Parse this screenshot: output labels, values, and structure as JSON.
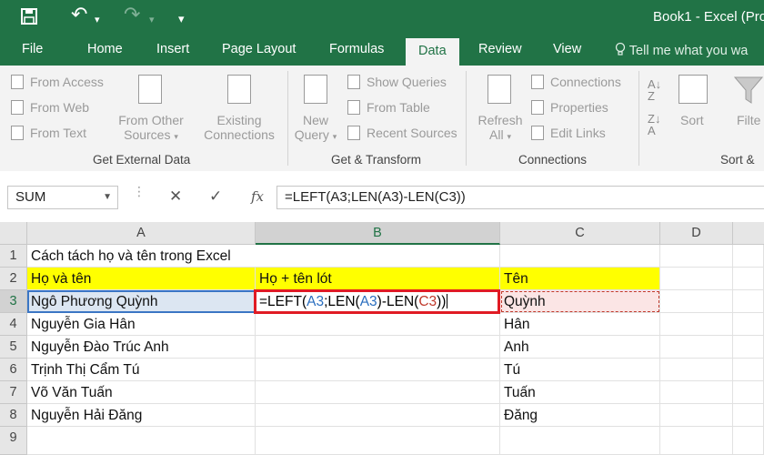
{
  "window": {
    "title": "Book1 - Excel (Pro"
  },
  "quick_access": {
    "save": "💾",
    "undo": "↶",
    "redo": "↷",
    "more": "▾"
  },
  "tabs": [
    {
      "label": "File"
    },
    {
      "label": "Home"
    },
    {
      "label": "Insert"
    },
    {
      "label": "Page Layout"
    },
    {
      "label": "Formulas"
    },
    {
      "label": "Data",
      "active": true
    },
    {
      "label": "Review"
    },
    {
      "label": "View"
    }
  ],
  "tell_me": {
    "icon": "lightbulb-icon",
    "text": "Tell me what you wa"
  },
  "ribbon": {
    "get_external_data": {
      "label": "Get External Data",
      "from_access": "From Access",
      "from_web": "From Web",
      "from_text": "From Text",
      "from_other_1": "From Other",
      "from_other_2": "Sources",
      "existing_1": "Existing",
      "existing_2": "Connections"
    },
    "get_transform": {
      "label": "Get & Transform",
      "new_query_1": "New",
      "new_query_2": "Query",
      "show_queries": "Show Queries",
      "from_table": "From Table",
      "recent_sources": "Recent Sources"
    },
    "connections": {
      "label": "Connections",
      "refresh_1": "Refresh",
      "refresh_2": "All",
      "connections": "Connections",
      "properties": "Properties",
      "edit_links": "Edit Links"
    },
    "sort_filter": {
      "label": "Sort &",
      "sort": "Sort",
      "filter": "Filte"
    }
  },
  "formula_bar": {
    "name_box": "SUM",
    "cancel": "✕",
    "enter": "✓",
    "fx": "fx",
    "formula": "=LEFT(A3;LEN(A3)-LEN(C3))"
  },
  "columns": [
    "A",
    "B",
    "C",
    "D"
  ],
  "rows": [
    "1",
    "2",
    "3",
    "4",
    "5",
    "6",
    "7",
    "8",
    "9"
  ],
  "cells": {
    "A1": "Cách tách họ và tên trong Excel",
    "A2": "Họ và tên",
    "B2": "Họ + tên lót",
    "C2": "Tên",
    "A3": "Ngô Phương Quỳnh",
    "C3": "Quỳnh",
    "A4": "Nguyễn Gia Hân",
    "C4": "Hân",
    "A5": "Nguyễn Đào Trúc Anh",
    "C5": "Anh",
    "A6": "Trịnh Thị Cẩm Tú",
    "C6": "Tú",
    "A7": "Võ Văn Tuấn",
    "C7": "Tuấn",
    "A8": "Nguyễn Hải Đăng",
    "C8": "Đăng"
  },
  "edit_cell": {
    "parts": [
      "=LEFT(",
      "A3",
      ";LEN(",
      "A3",
      ")-LEN(",
      "C3",
      "))"
    ]
  },
  "colors": {
    "excel_green": "#217346",
    "highlight_yellow": "#ffff00",
    "edit_border": "#e01b24",
    "ref_a": "#2a6ebf",
    "ref_c": "#c0392b"
  }
}
